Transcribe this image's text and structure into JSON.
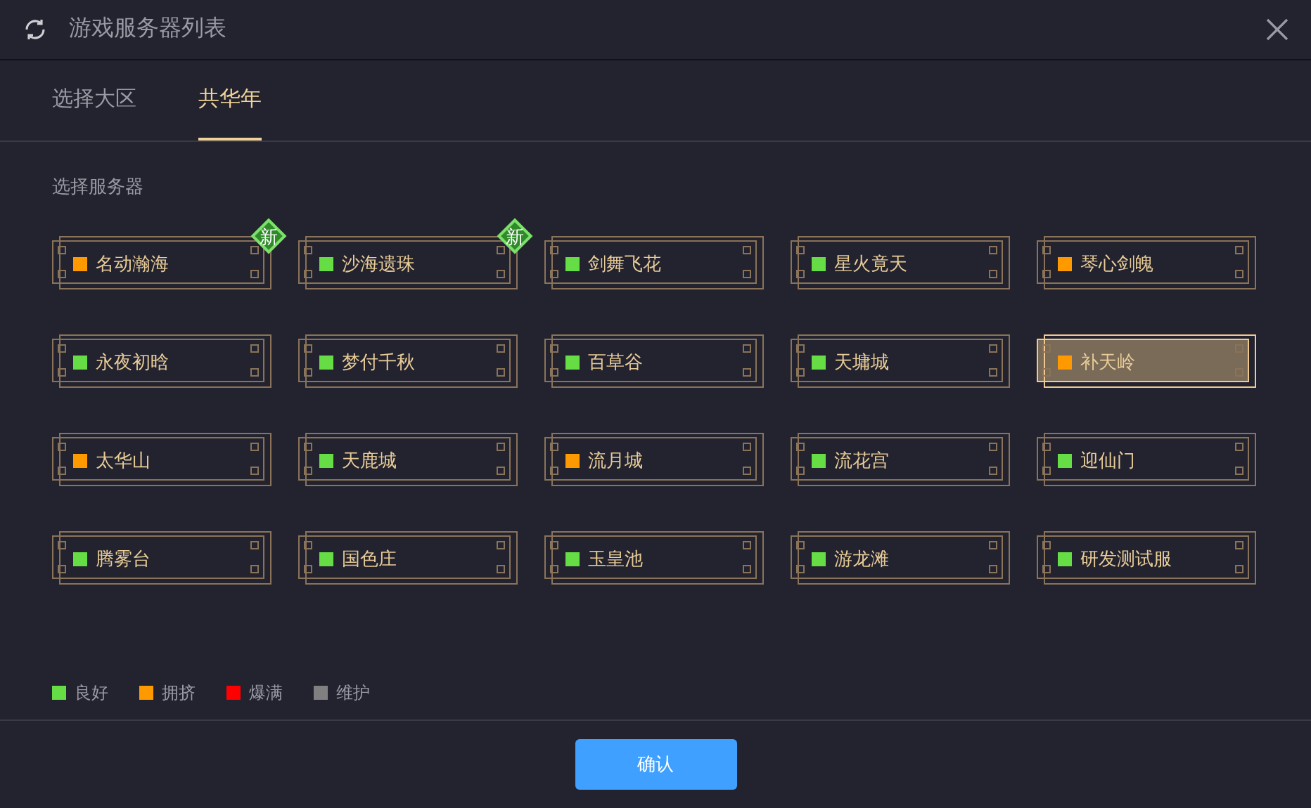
{
  "window": {
    "title": "游戏服务器列表"
  },
  "tabs": [
    {
      "label": "选择大区",
      "selected": false
    },
    {
      "label": "共华年",
      "selected": true
    }
  ],
  "section_label": "选择服务器",
  "servers": [
    {
      "name": "名动瀚海",
      "color": "#ff9900",
      "badge": "新",
      "selected": false
    },
    {
      "name": "沙海遗珠",
      "color": "#66dd44",
      "badge": "新",
      "selected": false
    },
    {
      "name": "剑舞飞花",
      "color": "#66dd44",
      "selected": false
    },
    {
      "name": "星火竟天",
      "color": "#66dd44",
      "selected": false
    },
    {
      "name": "琴心剑魄",
      "color": "#ff9900",
      "selected": false
    },
    {
      "name": "永夜初晗",
      "color": "#66dd44",
      "selected": false
    },
    {
      "name": "梦付千秋",
      "color": "#66dd44",
      "selected": false
    },
    {
      "name": "百草谷",
      "color": "#66dd44",
      "selected": false
    },
    {
      "name": "天墉城",
      "color": "#66dd44",
      "selected": false
    },
    {
      "name": "补天岭",
      "color": "#ff9900",
      "selected": true
    },
    {
      "name": "太华山",
      "color": "#ff9900",
      "selected": false
    },
    {
      "name": "天鹿城",
      "color": "#66dd44",
      "selected": false
    },
    {
      "name": "流月城",
      "color": "#ff9900",
      "selected": false
    },
    {
      "name": "流花宫",
      "color": "#66dd44",
      "selected": false
    },
    {
      "name": "迎仙门",
      "color": "#66dd44",
      "selected": false
    },
    {
      "name": "腾雾台",
      "color": "#66dd44",
      "selected": false
    },
    {
      "name": "国色庄",
      "color": "#66dd44",
      "selected": false
    },
    {
      "name": "玉皇池",
      "color": "#66dd44",
      "selected": false
    },
    {
      "name": "游龙滩",
      "color": "#66dd44",
      "selected": false
    },
    {
      "name": "研发测试服",
      "color": "#66dd44",
      "selected": false
    }
  ],
  "legend": [
    {
      "label": "良好",
      "color": "#66dd44"
    },
    {
      "label": "拥挤",
      "color": "#ff9900"
    },
    {
      "label": "爆满",
      "color": "#ff0000"
    },
    {
      "label": "维护",
      "color": "#808080"
    }
  ],
  "confirm_button": "确认"
}
